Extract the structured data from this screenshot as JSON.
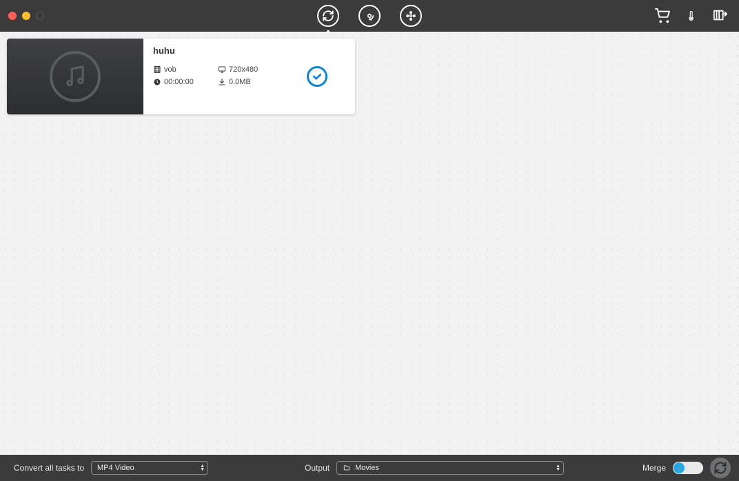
{
  "toolbar": {
    "modes": [
      "convert",
      "rip-disc",
      "movie"
    ],
    "active_mode_index": 0,
    "right_tools": [
      "cart",
      "thermometer",
      "media-library"
    ]
  },
  "file_card": {
    "title": "huhu",
    "format": "vob",
    "resolution": "720x480",
    "duration": "00:00:00",
    "size": "0.0MB",
    "selected": true
  },
  "bottom": {
    "convert_label": "Convert all tasks to",
    "convert_format": "MP4 Video",
    "output_label": "Output",
    "output_path": "Movies",
    "merge_label": "Merge",
    "merge_on": false
  }
}
